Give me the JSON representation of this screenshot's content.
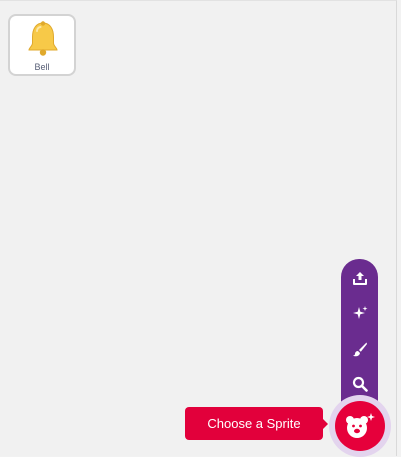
{
  "sprites": [
    {
      "name": "Bell",
      "icon": "bell-icon"
    }
  ],
  "sprite_menu": {
    "items": [
      {
        "name": "upload-sprite",
        "icon": "upload-icon"
      },
      {
        "name": "surprise-sprite",
        "icon": "sparkle-icon"
      },
      {
        "name": "paint-sprite",
        "icon": "paintbrush-icon"
      },
      {
        "name": "search-sprite",
        "icon": "search-icon"
      }
    ],
    "main_icon": "cat-face-plus-icon",
    "tooltip": "Choose a Sprite"
  },
  "colors": {
    "menu_bg": "#6a2c8f",
    "accent": "#e6003b",
    "tile_border": "#d3d3d3"
  }
}
